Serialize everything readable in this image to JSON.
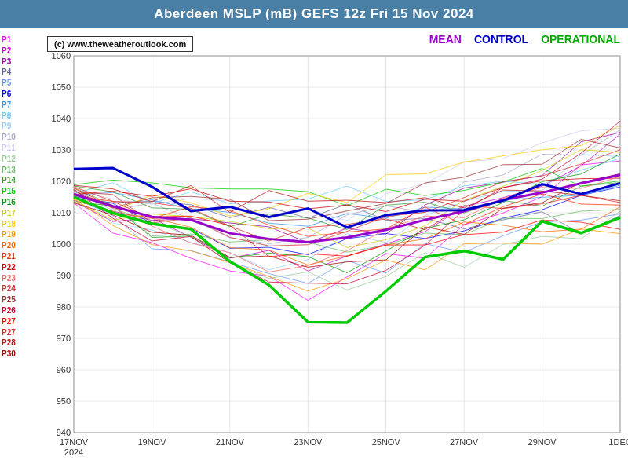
{
  "header": {
    "title": "Aberdeen MSLP (mB) GEFS 12z Fri 15 Nov 2024"
  },
  "watermark": "(c) www.theweatheroutlook.com",
  "legend_top": {
    "mean": "MEAN",
    "control": "CONTROL",
    "operational": "OPERATIONAL"
  },
  "legend_items": [
    {
      "label": "P1",
      "color": "#ff00ff"
    },
    {
      "label": "P2",
      "color": "#cc00cc"
    },
    {
      "label": "P3",
      "color": "#9900aa"
    },
    {
      "label": "P4",
      "color": "#666699"
    },
    {
      "label": "P5",
      "color": "#6699ff"
    },
    {
      "label": "P6",
      "color": "#0000ff"
    },
    {
      "label": "P7",
      "color": "#3399ff"
    },
    {
      "label": "P8",
      "color": "#66ccff"
    },
    {
      "label": "P9",
      "color": "#99ccff"
    },
    {
      "label": "P10",
      "color": "#aaaacc"
    },
    {
      "label": "P11",
      "color": "#ccccee"
    },
    {
      "label": "P12",
      "color": "#99cc99"
    },
    {
      "label": "P13",
      "color": "#66bb66"
    },
    {
      "label": "P14",
      "color": "#339933"
    },
    {
      "label": "P15",
      "color": "#00cc00"
    },
    {
      "label": "P16",
      "color": "#009900"
    },
    {
      "label": "P17",
      "color": "#cccc00"
    },
    {
      "label": "P18",
      "color": "#ffcc00"
    },
    {
      "label": "P19",
      "color": "#ff9900"
    },
    {
      "label": "P20",
      "color": "#ff6600"
    },
    {
      "label": "P21",
      "color": "#ff3300"
    },
    {
      "label": "P22",
      "color": "#cc0000"
    },
    {
      "label": "P23",
      "color": "#ff6666"
    },
    {
      "label": "P24",
      "color": "#cc3333"
    },
    {
      "label": "P25",
      "color": "#993333"
    },
    {
      "label": "P26",
      "color": "#cc0033"
    },
    {
      "label": "P27",
      "color": "#ff0000"
    },
    {
      "label": "P27",
      "color": "#dd2222"
    },
    {
      "label": "P28",
      "color": "#bb1111"
    },
    {
      "label": "P30",
      "color": "#aa0000"
    }
  ],
  "y_axis": {
    "min": 940,
    "max": 1060,
    "labels": [
      940,
      950,
      960,
      970,
      980,
      990,
      1000,
      1010,
      1020,
      1030,
      1040,
      1050,
      1060
    ]
  },
  "x_axis": {
    "labels": [
      "17NOV\n2024",
      "19NOV",
      "21NOV",
      "23NOV",
      "25NOV",
      "27NOV",
      "29NOV",
      "1DEC"
    ]
  },
  "colors": {
    "header_bg": "#4a7fa5",
    "mean": "#9900cc",
    "control": "#0000cc",
    "operational": "#00cc00"
  }
}
